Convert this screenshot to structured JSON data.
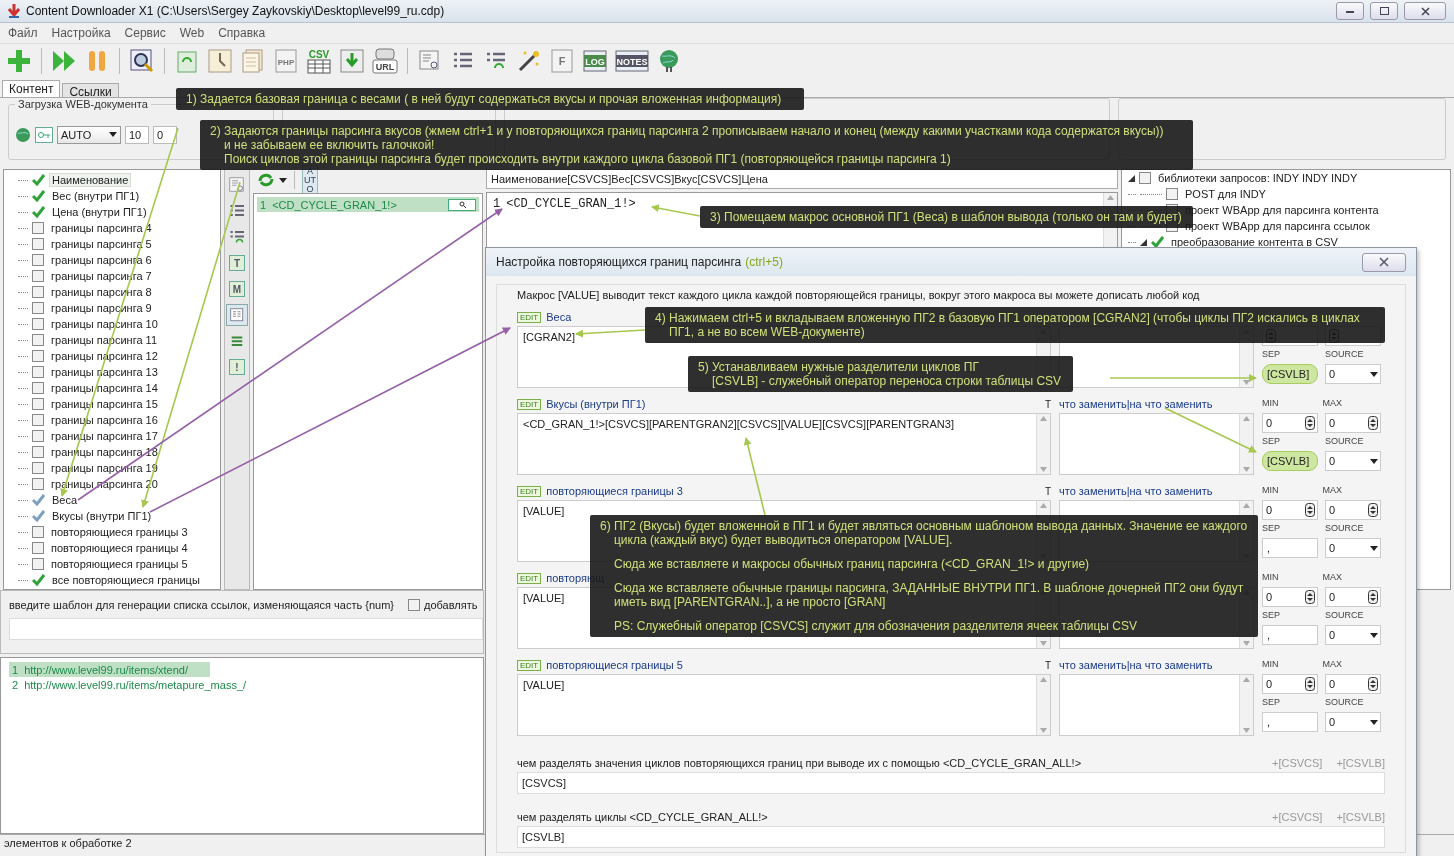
{
  "window": {
    "title": "Content Downloader X1 (C:\\Users\\Sergey Zaykovskiy\\Desktop\\level99_ru.cdp)"
  },
  "menu": [
    "Файл",
    "Настройка",
    "Сервис",
    "Web",
    "Справка"
  ],
  "toolbar": [
    {
      "kind": "add"
    },
    {
      "kind": "separator"
    },
    {
      "kind": "run"
    },
    {
      "kind": "pause"
    },
    {
      "kind": "separator"
    },
    {
      "kind": "preview"
    },
    {
      "kind": "separator"
    },
    {
      "kind": "refresh"
    },
    {
      "kind": "clock"
    },
    {
      "kind": "pages"
    },
    {
      "kind": "file",
      "label": "PHP"
    },
    {
      "kind": "table",
      "label": "CSV"
    },
    {
      "kind": "download"
    },
    {
      "kind": "robot",
      "label": "URL"
    },
    {
      "kind": "separator"
    },
    {
      "kind": "inspect"
    },
    {
      "kind": "list"
    },
    {
      "kind": "list-refresh"
    },
    {
      "kind": "wand"
    },
    {
      "kind": "file",
      "label": "F"
    },
    {
      "kind": "card",
      "label": "LOG"
    },
    {
      "kind": "card",
      "label": "NOTES"
    },
    {
      "kind": "globe"
    }
  ],
  "tabs": [
    {
      "label": "Контент",
      "selected": true
    },
    {
      "label": "Ссылки",
      "selected": false
    }
  ],
  "load_group": {
    "title": "Загрузка WEB-документа",
    "mode": "AUTO",
    "threads": "10",
    "delay": "0"
  },
  "bounds_tree": [
    {
      "label": "Наименование",
      "kind": "bound",
      "checked": true,
      "selected": true
    },
    {
      "label": "Вес (внутри ПГ1)",
      "kind": "bound",
      "checked": true,
      "selected": false
    },
    {
      "label": "Цена (внутри ПГ1)",
      "kind": "bound",
      "checked": true,
      "selected": false
    },
    {
      "label": "границы парсинга 4",
      "kind": "bound",
      "checked": false,
      "selected": false
    },
    {
      "label": "границы парсинга 5",
      "kind": "bound",
      "checked": false,
      "selected": false
    },
    {
      "label": "границы парсинга 6",
      "kind": "bound",
      "checked": false,
      "selected": false
    },
    {
      "label": "границы парсинга 7",
      "kind": "bound",
      "checked": false,
      "selected": false
    },
    {
      "label": "границы парсинга 8",
      "kind": "bound",
      "checked": false,
      "selected": false
    },
    {
      "label": "границы парсинга 9",
      "kind": "bound",
      "checked": false,
      "selected": false
    },
    {
      "label": "границы парсинга 10",
      "kind": "bound",
      "checked": false,
      "selected": false
    },
    {
      "label": "границы парсинга 11",
      "kind": "bound",
      "checked": false,
      "selected": false
    },
    {
      "label": "границы парсинга 12",
      "kind": "bound",
      "checked": false,
      "selected": false
    },
    {
      "label": "границы парсинга 13",
      "kind": "bound",
      "checked": false,
      "selected": false
    },
    {
      "label": "границы парсинга 14",
      "kind": "bound",
      "checked": false,
      "selected": false
    },
    {
      "label": "границы парсинга 15",
      "kind": "bound",
      "checked": false,
      "selected": false
    },
    {
      "label": "границы парсинга 16",
      "kind": "bound",
      "checked": false,
      "selected": false
    },
    {
      "label": "границы парсинга 17",
      "kind": "bound",
      "checked": false,
      "selected": false
    },
    {
      "label": "границы парсинга 18",
      "kind": "bound",
      "checked": false,
      "selected": false
    },
    {
      "label": "границы парсинга 19",
      "kind": "bound",
      "checked": false,
      "selected": false
    },
    {
      "label": "границы парсинга 20",
      "kind": "bound",
      "checked": false,
      "selected": false
    },
    {
      "label": "Веса",
      "kind": "repeating",
      "checked": true,
      "selected": false
    },
    {
      "label": "Вкусы (внутри ПГ1)",
      "kind": "repeating",
      "checked": true,
      "selected": false
    },
    {
      "label": "повторяющиеся границы 3",
      "kind": "repeating",
      "checked": false,
      "selected": false
    },
    {
      "label": "повторяющиеся границы 4",
      "kind": "repeating",
      "checked": false,
      "selected": false
    },
    {
      "label": "повторяющиеся границы 5",
      "kind": "repeating",
      "checked": false,
      "selected": false
    },
    {
      "label": "все повторяющиеся границы",
      "kind": "bound",
      "checked": true,
      "selected": false
    }
  ],
  "side_tools": [
    {
      "kind": "inspect",
      "selected": false
    },
    {
      "kind": "list",
      "selected": false
    },
    {
      "kind": "list-refresh",
      "selected": false
    },
    {
      "kind": "letter",
      "label": "T",
      "selected": false
    },
    {
      "kind": "letter",
      "label": "M",
      "selected": false
    },
    {
      "kind": "doc",
      "selected": true
    },
    {
      "kind": "bars",
      "selected": false
    },
    {
      "kind": "letter",
      "label": "!",
      "selected": false
    }
  ],
  "list_toolbar": {
    "auto_label": "AUTO"
  },
  "macro_list": [
    {
      "number": "1",
      "text": "<CD_CYCLE_GRAN_1!>",
      "selected": true
    }
  ],
  "output_header": "Наименование[CSVCS]Вес[CSVCS]Вкус[CSVCS]Цена",
  "output_code": [
    {
      "number": "1",
      "text": "<CD_CYCLE_GRAN_1!>"
    }
  ],
  "libraries_tree": [
    {
      "label": "библиотеки запросов: INDY INDY INDY",
      "checked": false,
      "expanded": true,
      "children": [
        {
          "label": "POST для INDY",
          "checked": false
        },
        {
          "label": "проект WBApp для парсинга контента",
          "checked": false
        },
        {
          "label": "проект WBApp для парсинга ссылок",
          "checked": false
        }
      ]
    },
    {
      "label": "преобразование контента в CSV",
      "checked": true,
      "expanded": true
    }
  ],
  "link_template": {
    "label": "введите шаблон для генерации списка ссылок, изменяющаяся часть {num}",
    "option_label": "добавлять",
    "checked": false
  },
  "urls": [
    {
      "number": "1",
      "url": "http://www.level99.ru/items/xtend/",
      "selected": true
    },
    {
      "number": "2",
      "url": "http://www.level99.ru/items/metapure_mass_/",
      "selected": false
    }
  ],
  "status_bar": "элементов к обработке 2",
  "dialog": {
    "title": "Настройка повторяющихся границ парсинга",
    "shortcut": "(ctrl+5)",
    "hint": "Макрос [VALUE] выводит текст каждого цикла каждой повторяющейся границы, вокруг этого макроса вы можете дописать любой код",
    "bounds": [
      {
        "badge": "EDIT",
        "label": "Веса",
        "template": "[CGRAN2]",
        "sep_label": "SEP",
        "source_label": "SOURCE",
        "sep": "[CSVLB]",
        "source": "0",
        "highlighted": true
      },
      {
        "badge": "EDIT",
        "label": "Вкусы (внутри ПГ1)",
        "t_label": "T",
        "replace_label": "что заменить|на что заменить",
        "template": "<CD_GRAN_1!>[CSVCS][PARENTGRAN2][CSVCS][VALUE][CSVCS][PARENTGRAN3]",
        "min_label": "MIN",
        "max_label": "MAX",
        "min": "0",
        "max": "0",
        "sep_label": "SEP",
        "source_label": "SOURCE",
        "sep": "[CSVLB]",
        "source": "0",
        "highlighted": true
      },
      {
        "badge": "EDIT",
        "label": "повторяющиеся границы 3",
        "t_label": "T",
        "replace_label": "что заменить|на что заменить",
        "template": "[VALUE]",
        "min_label": "MIN",
        "max_label": "MAX",
        "min": "0",
        "max": "0",
        "sep_label": "SEP",
        "source_label": "SOURCE",
        "sep": ",",
        "source": "0",
        "highlighted": false
      },
      {
        "badge": "EDIT",
        "label": "повторяющ",
        "template": "[VALUE]",
        "min_label": "MIN",
        "max_label": "MAX",
        "min": "0",
        "max": "0",
        "sep_label": "SEP",
        "source_label": "SOURCE",
        "sep": ",",
        "source": "0",
        "highlighted": false
      },
      {
        "badge": "EDIT",
        "label": "повторяющиеся границы 5",
        "t_label": "T",
        "replace_label": "что заменить|на что заменить",
        "template": "[VALUE]",
        "min_label": "MIN",
        "max_label": "MAX",
        "min": "0",
        "max": "0",
        "sep_label": "SEP",
        "source_label": "SOURCE",
        "sep": ",",
        "source": "0",
        "highlighted": false
      }
    ],
    "separators": [
      {
        "label": "чем разделять значения циклов повторяющихся границ при выводе их с помощью <CD_CYCLE_GRAN_ALL!>",
        "buttons": [
          "+[CSVCS]",
          "+[CSVLB]"
        ],
        "value": "[CSVCS]"
      },
      {
        "label": "чем разделять циклы <CD_CYCLE_GRAN_ALL!>",
        "buttons": [
          "+[CSVCS]",
          "+[CSVLB]"
        ],
        "value": "[CSVLB]"
      }
    ]
  },
  "annotations": [
    {
      "paragraphs": [
        [
          "1) Задается базовая граница с весами ( в ней будут содержаться вкусы и прочая вложенная информация)"
        ]
      ]
    },
    {
      "paragraphs": [
        [
          "2) Задаются границы парсинга вкусов (жмем ctrl+1 и у повторяющихся границ парсинга 2 прописываем начало и конец (между какими участками кода содержатся вкусы))",
          "и не забываем ее включить галочкой!",
          "Поиск циклов этой границы парсинга будет происходить внутри каждого цикла базовой ПГ1 (повторяющейся границы парсинга 1)"
        ]
      ]
    },
    {
      "paragraphs": [
        [
          "3) Помещаем макрос основной ПГ1 (Веса) в шаблон вывода (только он там и будет)"
        ]
      ]
    },
    {
      "paragraphs": [
        [
          "4) Нажимаем ctrl+5 и вкладываем вложенную ПГ2 в базовую ПГ1 оператором [CGRAN2] (чтобы циклы ПГ2 искались в циклах",
          "ПГ1, а не во всем WEB-документе)"
        ]
      ]
    },
    {
      "paragraphs": [
        [
          "5) Устанавливаем нужные разделители циклов ПГ",
          "[CSVLB] - служебный оператор переноса строки таблицы CSV"
        ]
      ]
    },
    {
      "paragraphs": [
        [
          "6) ПГ2 (Вкусы) будет вложенной в ПГ1 и будет являться основным шаблоном вывода данных. Значение ее каждого",
          "цикла (каждый вкус) будет выводиться оператором [VALUE]."
        ],
        [
          "Сюда же вставляете и макросы обычных границ парсинга (<CD_GRAN_1!> и другие)"
        ],
        [
          "Сюда же вставляете обычные границы парсинга, ЗАДАННЫЕ ВНУТРИ ПГ1. В шаблоне дочерней ПГ2 они будут",
          "иметь вид [PARENTGRAN..], а не просто [GRAN]"
        ],
        [
          "PS: Служебный оператор [CSVCS] служит для обозначения разделителя ячеек таблицы CSV"
        ]
      ]
    }
  ]
}
